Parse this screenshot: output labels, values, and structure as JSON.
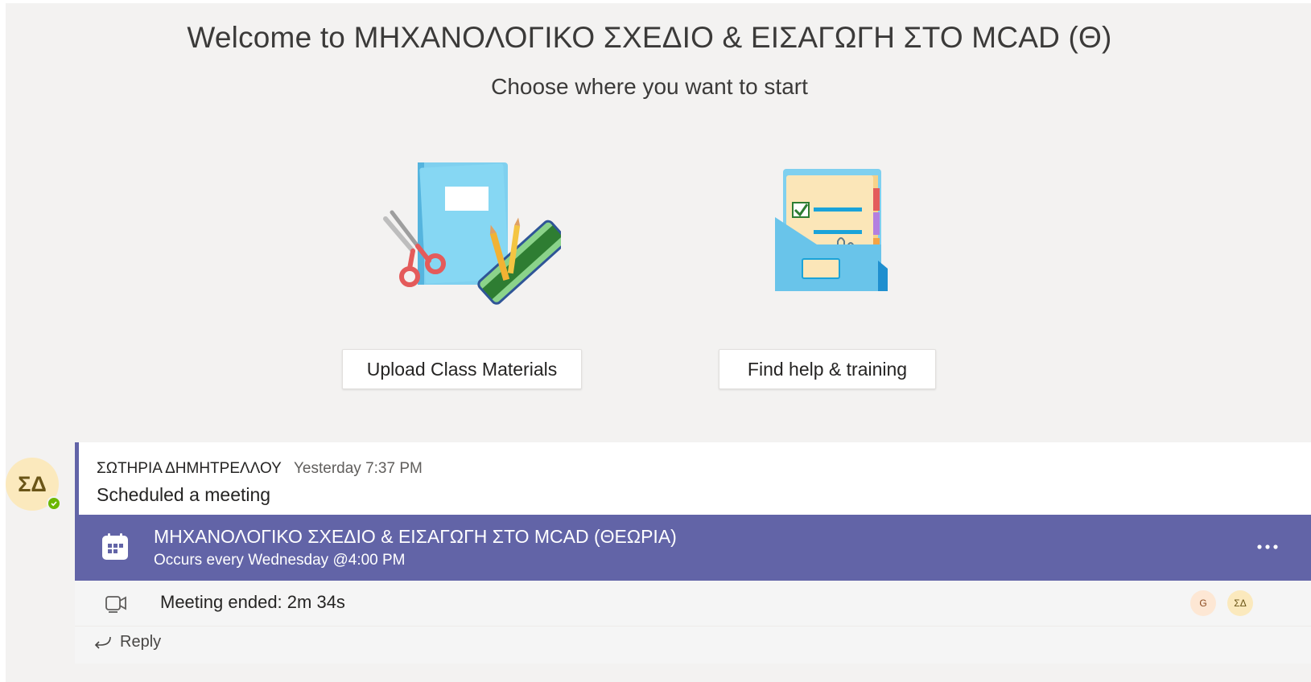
{
  "welcome": {
    "title": "Welcome to ΜΗΧΑΝΟΛΟΓΙΚΟ ΣΧΕΔΙΟ & ΕΙΣΑΓΩΓΗ ΣΤΟ MCAD (Θ)",
    "subtitle": "Choose where you want to start"
  },
  "actions": {
    "upload_label": "Upload Class Materials",
    "help_label": "Find help & training"
  },
  "post": {
    "avatar_initials": "ΣΔ",
    "author": "ΣΩΤΗΡΙΑ ΔΗΜΗΤΡΕΛΛΟΥ",
    "timestamp": "Yesterday 7:37 PM",
    "text": "Scheduled a meeting",
    "meeting": {
      "title": "ΜΗΧΑΝΟΛΟΓΙΚΟ ΣΧΕΔΙΟ & ΕΙΣΑΓΩΓΗ ΣΤΟ MCAD (ΘΕΩΡΙΑ)",
      "recurrence": "Occurs every Wednesday @4:00 PM",
      "more_label": "..."
    },
    "ended": {
      "text": "Meeting ended: 2m 34s",
      "participants": [
        "G",
        "ΣΔ"
      ]
    },
    "reply_label": "Reply"
  },
  "colors": {
    "accent": "#6264a7",
    "presence": "#6bb700",
    "background": "#f3f2f1"
  },
  "icons": [
    "calendar-icon",
    "video-camera-icon",
    "reply-arrow-icon",
    "more-options-icon",
    "checkmark-icon"
  ]
}
